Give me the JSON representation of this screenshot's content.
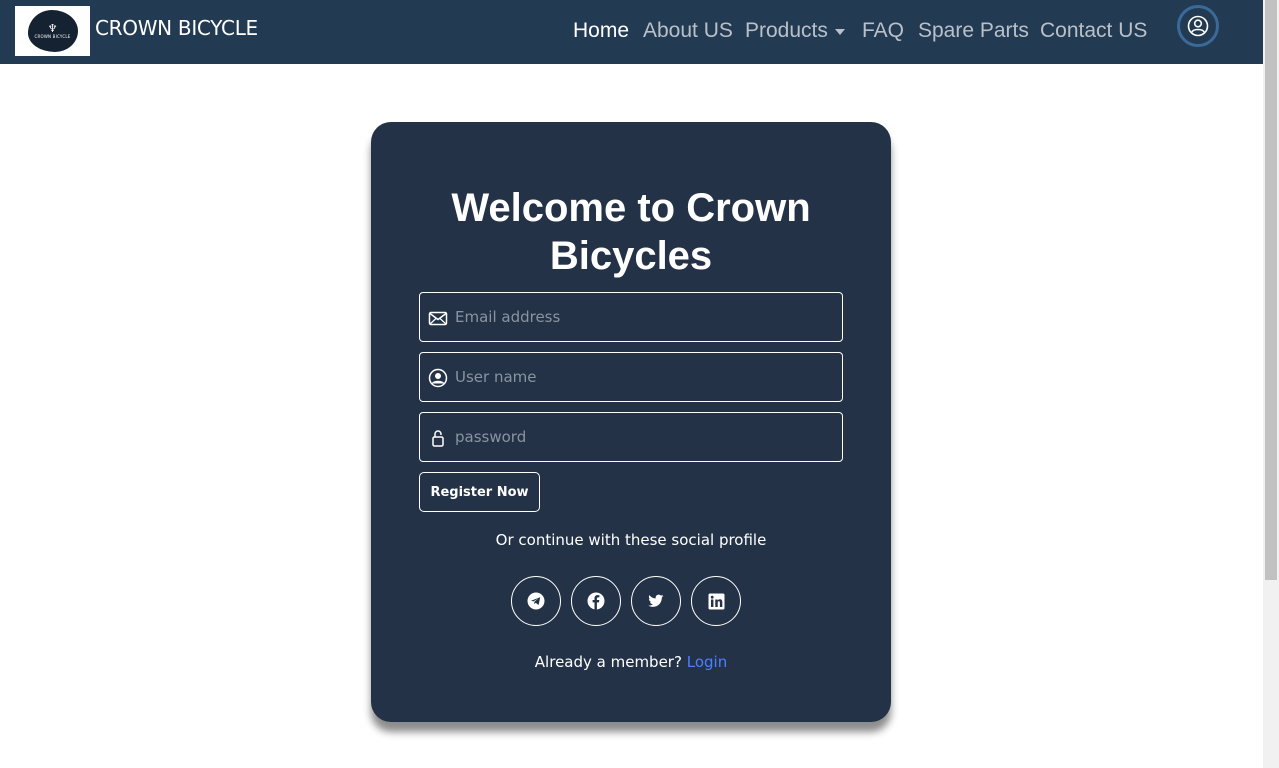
{
  "navbar": {
    "brand_name": "CROWN BICYCLE",
    "logo_text": "CROWN BICYCLE",
    "links": [
      {
        "label": "Home",
        "active": true
      },
      {
        "label": "About US",
        "active": false
      },
      {
        "label": "Products",
        "active": false
      },
      {
        "label": "FAQ",
        "active": false
      },
      {
        "label": "Spare Parts",
        "active": false
      },
      {
        "label": "Contact US",
        "active": false
      }
    ],
    "products_dropdown_icon": "caret-down-icon",
    "profile_icon": "user-circle-icon"
  },
  "form": {
    "title": "Welcome to Crown Bicycles",
    "email": {
      "placeholder": "Email address",
      "value": "",
      "icon": "envelope-icon"
    },
    "username": {
      "placeholder": "User name",
      "value": "",
      "icon": "user-circle-icon"
    },
    "password": {
      "placeholder": "password",
      "value": "",
      "icon": "lock-icon"
    },
    "register_label": "Register Now",
    "social_text": "Or continue with these social profile",
    "social_icons": [
      "telegram-icon",
      "facebook-icon",
      "twitter-icon",
      "linkedin-icon"
    ],
    "member_text": "Already a member?",
    "login_label": "Login"
  },
  "colors": {
    "navbar_bg": "#233a53",
    "card_bg": "#233246",
    "link_accent": "#4a80ff",
    "nav_inactive": "#b9c0c8"
  }
}
